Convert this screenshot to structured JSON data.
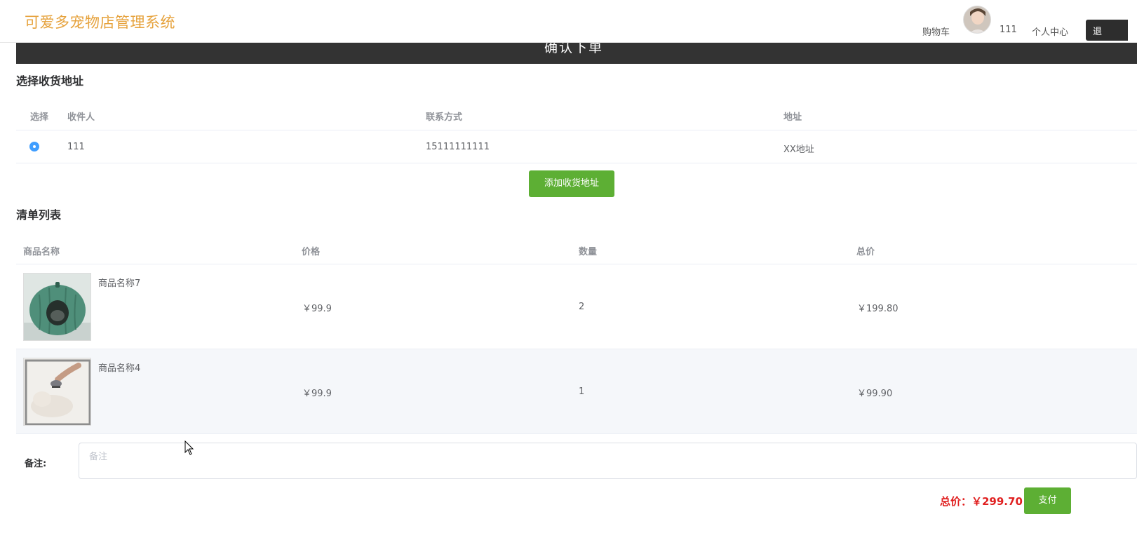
{
  "header": {
    "logo": "可爱多宠物店管理系统",
    "cart": "购物车",
    "username": "111",
    "profile": "个人中心",
    "logout": "退"
  },
  "page_title": "确认下单",
  "address_section": {
    "title": "选择收货地址",
    "columns": {
      "select": "选择",
      "recipient": "收件人",
      "contact": "联系方式",
      "address": "地址"
    },
    "rows": [
      {
        "recipient": "111",
        "contact": "15111111111",
        "address": "XX地址",
        "selected": true
      }
    ],
    "add_button": "添加收货地址"
  },
  "items_section": {
    "title": "清单列表",
    "columns": {
      "name": "商品名称",
      "price": "价格",
      "quantity": "数量",
      "subtotal": "总价"
    },
    "rows": [
      {
        "name": "商品名称7",
        "price": "￥99.9",
        "quantity": "2",
        "subtotal": "￥199.80",
        "image": "pet-bed-image"
      },
      {
        "name": "商品名称4",
        "price": "￥99.9",
        "quantity": "1",
        "subtotal": "￥99.90",
        "image": "cat-grooming-image"
      }
    ]
  },
  "remark": {
    "label": "备注:",
    "placeholder": "备注",
    "value": ""
  },
  "footer": {
    "total": "总价：￥299.70",
    "pay_button": "支付"
  },
  "colors": {
    "logo": "#e6a23c",
    "title_bar": "#333333",
    "green_button": "#5daf34",
    "total_text": "#e02020",
    "radio": "#409eff"
  }
}
